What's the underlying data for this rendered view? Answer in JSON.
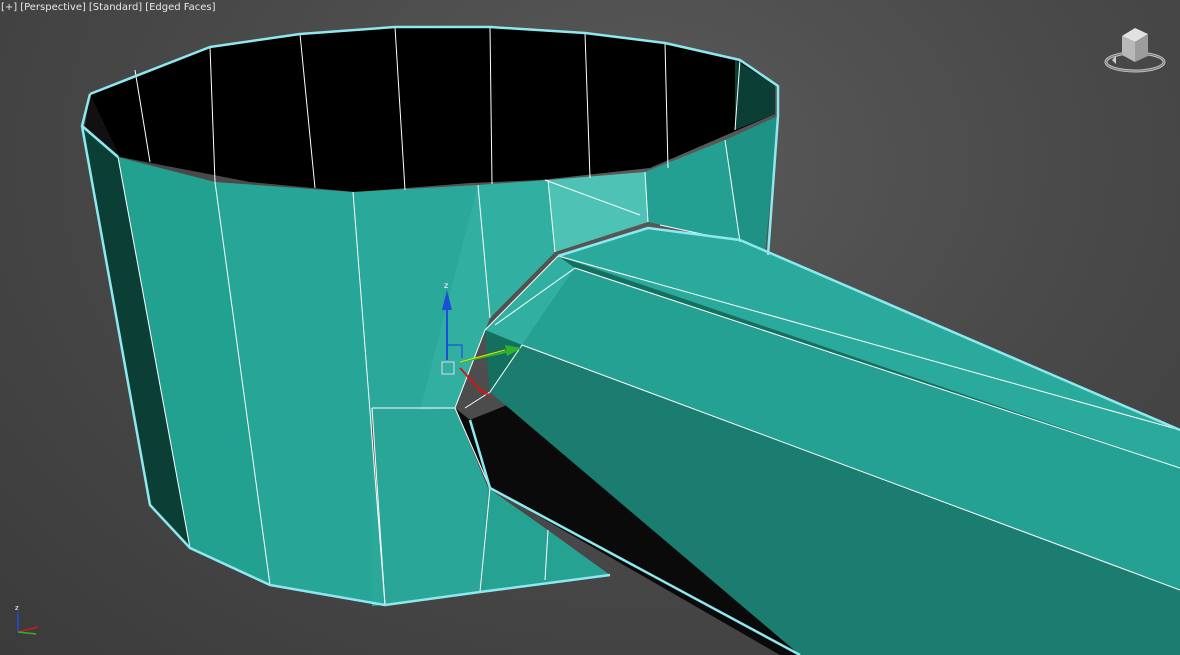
{
  "viewport": {
    "labels": [
      "[+]",
      "[Perspective]",
      "[Standard]",
      "[Edged Faces]"
    ],
    "background": "#4a4a4a",
    "view": "Perspective",
    "shading": "Standard",
    "display_mode": "Edged Faces"
  },
  "model": {
    "color_light": "#2aaa9c",
    "color_mid": "#229c8f",
    "color_dark": "#13705f",
    "color_darkest": "#0b3f36",
    "outline_color": "#8ee8f0",
    "edge_color": "#ffffff"
  },
  "gizmo": {
    "z_axis_label": "z",
    "x_color": "#d01818",
    "y_color": "#2eb32e",
    "z_color": "#1a4fd8"
  },
  "world_axis": {
    "z_label": "z",
    "x_color": "#d01818",
    "y_color": "#2eb32e",
    "z_color": "#1a4fd8"
  },
  "viewcube": {
    "icon": "viewcube-icon"
  }
}
